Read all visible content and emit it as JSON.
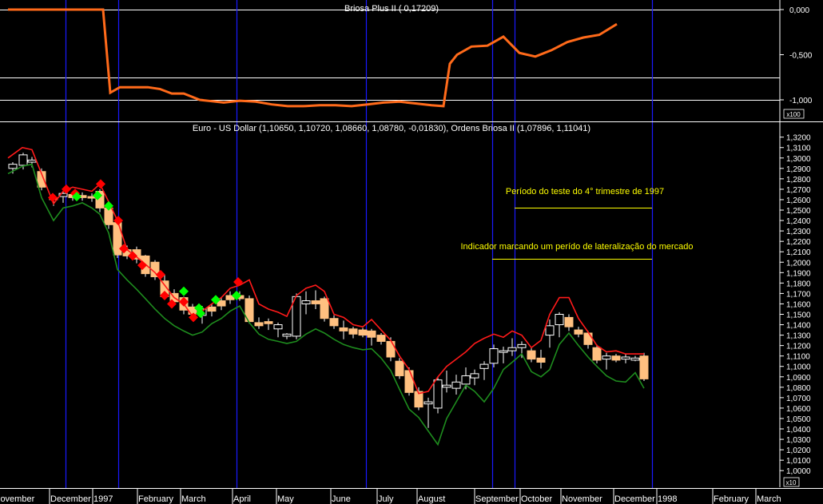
{
  "colors": {
    "background": "#000000",
    "indicator_line": "#ff6a1a",
    "upper_band": "#ff1a1a",
    "lower_band": "#1e8c1e",
    "candle_fill": "#ffc080",
    "annotation": "#ffff00",
    "vertical_marker": "#1a1aff",
    "buy_marker": "#00ff00",
    "sell_marker": "#ff0000"
  },
  "top_panel": {
    "title": "Briosa Plus II ( 0,17209)",
    "unit_label": "x100"
  },
  "main_panel": {
    "title": "Euro - US Dollar (1,10650, 1,10720, 1,08660, 1,08780, -0,01830), Ordens Briosa II (1,07896, 1,11041)",
    "unit_label": "x10"
  },
  "annotations": {
    "test_period": "Período do teste do 4° trimestre de 1997",
    "sideways": "Indicador marcando um perído de lateralização do mercado"
  },
  "chart_data": [
    {
      "type": "line",
      "title": "Briosa Plus II ( 0,17209)",
      "y_ticks": [
        "0,000",
        "-0,500",
        "-1,000"
      ],
      "ylim": [
        -1.1,
        0.0
      ],
      "unit": "x100",
      "series": [
        {
          "name": "Briosa Plus II",
          "x": [
            0,
            3,
            6,
            9,
            11.9,
            12.8,
            14,
            16,
            17.5,
            19,
            20.5,
            22,
            24,
            27,
            29,
            31,
            33,
            35,
            37,
            39,
            41,
            43,
            45,
            47,
            49,
            51,
            53,
            54.5,
            55.3,
            56.2,
            58,
            60,
            62,
            64,
            66,
            68,
            70,
            72,
            74,
            76.2
          ],
          "values": [
            0.0,
            0.0,
            0.0,
            0.0,
            0.0,
            -0.92,
            -0.86,
            -0.86,
            -0.86,
            -0.88,
            -0.93,
            -0.93,
            -1.0,
            -1.03,
            -1.01,
            -1.02,
            -1.05,
            -1.07,
            -1.07,
            -1.06,
            -1.06,
            -1.07,
            -1.05,
            -1.03,
            -1.02,
            -1.04,
            -1.06,
            -1.07,
            -0.6,
            -0.5,
            -0.41,
            -0.4,
            -0.3,
            -0.48,
            -0.52,
            -0.45,
            -0.36,
            -0.31,
            -0.28,
            -0.16
          ]
        }
      ],
      "horizontal_lines": [
        0.0,
        -0.75,
        -1.0
      ]
    },
    {
      "type": "candlestick",
      "title": "Euro - US Dollar (1,10650, 1,10720, 1,08660, 1,08780, -0,01830), Ordens Briosa II (1,07896, 1,11041)",
      "ylim": [
        1.0,
        1.33
      ],
      "y_ticks": [
        "1,3200",
        "1,3100",
        "1,3000",
        "1,2900",
        "1,2800",
        "1,2700",
        "1,2600",
        "1,2500",
        "1,2400",
        "1,2300",
        "1,2200",
        "1,2100",
        "1,2000",
        "1,1900",
        "1,1800",
        "1,1700",
        "1,1600",
        "1,1500",
        "1,1400",
        "1,1300",
        "1,1200",
        "1,1100",
        "1,1000",
        "1,0900",
        "1,0800",
        "1,0700",
        "1,0600",
        "1,0500",
        "1,0400",
        "1,0300",
        "1,0200",
        "1,0100",
        "1,0000"
      ],
      "x_labels": [
        "lovember",
        "December",
        "1997",
        "February",
        "March",
        "April",
        "May",
        "June",
        "July",
        "August",
        "September",
        "October",
        "November",
        "December",
        "1998",
        "February",
        "March"
      ],
      "unit": "x10",
      "candles": [
        {
          "x": 0.6,
          "o": 1.29,
          "h": 1.296,
          "l": 1.285,
          "c": 1.294
        },
        {
          "x": 1.9,
          "o": 1.293,
          "h": 1.305,
          "l": 1.289,
          "c": 1.303
        },
        {
          "x": 3.0,
          "o": 1.296,
          "h": 1.301,
          "l": 1.291,
          "c": 1.298
        },
        {
          "x": 4.2,
          "o": 1.287,
          "h": 1.29,
          "l": 1.269,
          "c": 1.272
        },
        {
          "x": 5.7,
          "o": 1.262,
          "h": 1.265,
          "l": 1.254,
          "c": 1.26
        },
        {
          "x": 6.9,
          "o": 1.263,
          "h": 1.268,
          "l": 1.257,
          "c": 1.266
        },
        {
          "x": 8.1,
          "o": 1.265,
          "h": 1.268,
          "l": 1.259,
          "c": 1.262
        },
        {
          "x": 9.3,
          "o": 1.264,
          "h": 1.267,
          "l": 1.259,
          "c": 1.262
        },
        {
          "x": 10.5,
          "o": 1.263,
          "h": 1.266,
          "l": 1.258,
          "c": 1.262
        },
        {
          "x": 11.5,
          "o": 1.268,
          "h": 1.27,
          "l": 1.248,
          "c": 1.252
        },
        {
          "x": 12.6,
          "o": 1.252,
          "h": 1.256,
          "l": 1.232,
          "c": 1.236
        },
        {
          "x": 13.7,
          "o": 1.238,
          "h": 1.24,
          "l": 1.204,
          "c": 1.207
        },
        {
          "x": 14.9,
          "o": 1.212,
          "h": 1.216,
          "l": 1.203,
          "c": 1.206
        },
        {
          "x": 16.1,
          "o": 1.212,
          "h": 1.215,
          "l": 1.199,
          "c": 1.203
        },
        {
          "x": 17.2,
          "o": 1.206,
          "h": 1.207,
          "l": 1.186,
          "c": 1.189
        },
        {
          "x": 18.4,
          "o": 1.2,
          "h": 1.202,
          "l": 1.183,
          "c": 1.186
        },
        {
          "x": 19.6,
          "o": 1.182,
          "h": 1.188,
          "l": 1.164,
          "c": 1.167
        },
        {
          "x": 20.8,
          "o": 1.17,
          "h": 1.174,
          "l": 1.159,
          "c": 1.162
        },
        {
          "x": 22.0,
          "o": 1.166,
          "h": 1.167,
          "l": 1.15,
          "c": 1.154
        },
        {
          "x": 23.1,
          "o": 1.157,
          "h": 1.16,
          "l": 1.145,
          "c": 1.15
        },
        {
          "x": 24.3,
          "o": 1.149,
          "h": 1.158,
          "l": 1.141,
          "c": 1.155
        },
        {
          "x": 25.5,
          "o": 1.157,
          "h": 1.16,
          "l": 1.148,
          "c": 1.153
        },
        {
          "x": 26.7,
          "o": 1.163,
          "h": 1.166,
          "l": 1.154,
          "c": 1.158
        },
        {
          "x": 27.8,
          "o": 1.168,
          "h": 1.172,
          "l": 1.16,
          "c": 1.164
        },
        {
          "x": 29.0,
          "o": 1.168,
          "h": 1.172,
          "l": 1.163,
          "c": 1.165
        },
        {
          "x": 30.2,
          "o": 1.165,
          "h": 1.168,
          "l": 1.141,
          "c": 1.143
        },
        {
          "x": 31.4,
          "o": 1.142,
          "h": 1.147,
          "l": 1.136,
          "c": 1.139
        },
        {
          "x": 32.6,
          "o": 1.143,
          "h": 1.146,
          "l": 1.135,
          "c": 1.141
        },
        {
          "x": 33.8,
          "o": 1.136,
          "h": 1.142,
          "l": 1.128,
          "c": 1.14
        },
        {
          "x": 34.9,
          "o": 1.129,
          "h": 1.132,
          "l": 1.126,
          "c": 1.131
        },
        {
          "x": 36.1,
          "o": 1.129,
          "h": 1.17,
          "l": 1.126,
          "c": 1.167
        },
        {
          "x": 37.3,
          "o": 1.16,
          "h": 1.172,
          "l": 1.15,
          "c": 1.163
        },
        {
          "x": 38.5,
          "o": 1.163,
          "h": 1.173,
          "l": 1.155,
          "c": 1.16
        },
        {
          "x": 39.6,
          "o": 1.165,
          "h": 1.167,
          "l": 1.143,
          "c": 1.146
        },
        {
          "x": 40.8,
          "o": 1.146,
          "h": 1.149,
          "l": 1.136,
          "c": 1.139
        },
        {
          "x": 42.0,
          "o": 1.137,
          "h": 1.144,
          "l": 1.126,
          "c": 1.134
        },
        {
          "x": 43.2,
          "o": 1.136,
          "h": 1.138,
          "l": 1.127,
          "c": 1.131
        },
        {
          "x": 44.4,
          "o": 1.135,
          "h": 1.137,
          "l": 1.128,
          "c": 1.13
        },
        {
          "x": 45.5,
          "o": 1.134,
          "h": 1.136,
          "l": 1.12,
          "c": 1.128
        },
        {
          "x": 46.7,
          "o": 1.13,
          "h": 1.132,
          "l": 1.121,
          "c": 1.124
        },
        {
          "x": 47.9,
          "o": 1.124,
          "h": 1.128,
          "l": 1.105,
          "c": 1.109
        },
        {
          "x": 49.0,
          "o": 1.105,
          "h": 1.108,
          "l": 1.088,
          "c": 1.091
        },
        {
          "x": 50.2,
          "o": 1.096,
          "h": 1.099,
          "l": 1.072,
          "c": 1.075
        },
        {
          "x": 51.4,
          "o": 1.076,
          "h": 1.08,
          "l": 1.058,
          "c": 1.061
        },
        {
          "x": 52.6,
          "o": 1.064,
          "h": 1.07,
          "l": 1.041,
          "c": 1.066
        },
        {
          "x": 53.8,
          "o": 1.06,
          "h": 1.09,
          "l": 1.055,
          "c": 1.087
        },
        {
          "x": 54.9,
          "o": 1.08,
          "h": 1.096,
          "l": 1.075,
          "c": 1.082
        },
        {
          "x": 56.1,
          "o": 1.079,
          "h": 1.092,
          "l": 1.073,
          "c": 1.085
        },
        {
          "x": 57.3,
          "o": 1.083,
          "h": 1.099,
          "l": 1.078,
          "c": 1.091
        },
        {
          "x": 58.4,
          "o": 1.089,
          "h": 1.097,
          "l": 1.082,
          "c": 1.093
        },
        {
          "x": 59.6,
          "o": 1.098,
          "h": 1.105,
          "l": 1.087,
          "c": 1.102
        },
        {
          "x": 60.8,
          "o": 1.103,
          "h": 1.121,
          "l": 1.099,
          "c": 1.117
        },
        {
          "x": 62.0,
          "o": 1.114,
          "h": 1.119,
          "l": 1.103,
          "c": 1.115
        },
        {
          "x": 63.1,
          "o": 1.115,
          "h": 1.127,
          "l": 1.11,
          "c": 1.118
        },
        {
          "x": 64.3,
          "o": 1.118,
          "h": 1.124,
          "l": 1.108,
          "c": 1.121
        },
        {
          "x": 65.5,
          "o": 1.115,
          "h": 1.118,
          "l": 1.104,
          "c": 1.107
        },
        {
          "x": 66.7,
          "o": 1.108,
          "h": 1.116,
          "l": 1.098,
          "c": 1.104
        },
        {
          "x": 67.8,
          "o": 1.13,
          "h": 1.145,
          "l": 1.118,
          "c": 1.139
        },
        {
          "x": 69.0,
          "o": 1.14,
          "h": 1.152,
          "l": 1.128,
          "c": 1.15
        },
        {
          "x": 70.2,
          "o": 1.147,
          "h": 1.15,
          "l": 1.134,
          "c": 1.138
        },
        {
          "x": 71.4,
          "o": 1.135,
          "h": 1.138,
          "l": 1.128,
          "c": 1.131
        },
        {
          "x": 72.6,
          "o": 1.132,
          "h": 1.134,
          "l": 1.117,
          "c": 1.121
        },
        {
          "x": 73.7,
          "o": 1.118,
          "h": 1.121,
          "l": 1.103,
          "c": 1.106
        },
        {
          "x": 74.9,
          "o": 1.107,
          "h": 1.113,
          "l": 1.097,
          "c": 1.11
        },
        {
          "x": 76.1,
          "o": 1.11,
          "h": 1.112,
          "l": 1.104,
          "c": 1.106
        },
        {
          "x": 77.3,
          "o": 1.107,
          "h": 1.112,
          "l": 1.103,
          "c": 1.109
        },
        {
          "x": 78.5,
          "o": 1.106,
          "h": 1.11,
          "l": 1.105,
          "c": 1.108
        },
        {
          "x": 79.6,
          "o": 1.11,
          "h": 1.113,
          "l": 1.086,
          "c": 1.088
        }
      ],
      "series": [
        {
          "name": "upper",
          "x": [
            0,
            1.8,
            3.0,
            4.2,
            5.7,
            6.9,
            8.1,
            9.3,
            10.5,
            11.5,
            12.6,
            13.7,
            14.9,
            16.1,
            17.2,
            18.4,
            19.6,
            20.8,
            22.0,
            23.1,
            24.3,
            25.5,
            26.7,
            27.8,
            29.0,
            30.2,
            31.4,
            32.6,
            33.8,
            34.9,
            36.1,
            37.3,
            38.5,
            39.6,
            40.8,
            42.0,
            43.2,
            44.4,
            45.5,
            46.7,
            47.9,
            49.0,
            50.2,
            51.4,
            52.6,
            53.8,
            54.9,
            56.1,
            57.3,
            58.4,
            59.6,
            60.8,
            62.0,
            63.1,
            64.3,
            65.5,
            66.7,
            67.8,
            69.0,
            70.2,
            71.4,
            72.6,
            73.7,
            74.9,
            76.1,
            77.3,
            78.5,
            79.6
          ],
          "values": [
            1.3,
            1.31,
            1.308,
            1.285,
            1.256,
            1.268,
            1.272,
            1.27,
            1.268,
            1.275,
            1.258,
            1.24,
            1.212,
            1.205,
            1.198,
            1.19,
            1.178,
            1.166,
            1.16,
            1.148,
            1.153,
            1.16,
            1.166,
            1.175,
            1.178,
            1.183,
            1.16,
            1.155,
            1.152,
            1.148,
            1.168,
            1.175,
            1.178,
            1.172,
            1.15,
            1.147,
            1.14,
            1.138,
            1.145,
            1.135,
            1.125,
            1.11,
            1.097,
            1.074,
            1.076,
            1.09,
            1.1,
            1.107,
            1.114,
            1.122,
            1.127,
            1.131,
            1.128,
            1.134,
            1.13,
            1.118,
            1.125,
            1.15,
            1.166,
            1.166,
            1.146,
            1.133,
            1.12,
            1.114,
            1.115,
            1.112,
            1.112,
            1.112
          ]
        },
        {
          "name": "lower",
          "x": [
            0,
            1.8,
            3.0,
            4.2,
            5.7,
            6.9,
            8.1,
            9.3,
            10.5,
            11.5,
            12.6,
            13.7,
            14.9,
            16.1,
            17.2,
            18.4,
            19.6,
            20.8,
            22.0,
            23.1,
            24.3,
            25.5,
            26.7,
            27.8,
            29.0,
            30.2,
            31.4,
            32.6,
            33.8,
            34.9,
            36.1,
            37.3,
            38.5,
            39.6,
            40.8,
            42.0,
            43.2,
            44.4,
            45.5,
            46.7,
            47.9,
            49.0,
            50.2,
            51.4,
            52.6,
            53.8,
            54.9,
            56.1,
            57.3,
            58.4,
            59.6,
            60.8,
            62.0,
            63.1,
            64.3,
            65.5,
            66.7,
            67.8,
            69.0,
            70.2,
            71.4,
            72.6,
            73.7,
            74.9,
            76.1,
            77.3,
            78.5,
            79.6
          ],
          "values": [
            1.285,
            1.292,
            1.294,
            1.262,
            1.24,
            1.252,
            1.254,
            1.257,
            1.252,
            1.246,
            1.228,
            1.193,
            1.183,
            1.174,
            1.165,
            1.155,
            1.146,
            1.139,
            1.134,
            1.13,
            1.133,
            1.141,
            1.146,
            1.153,
            1.158,
            1.142,
            1.131,
            1.126,
            1.124,
            1.122,
            1.124,
            1.131,
            1.136,
            1.132,
            1.126,
            1.121,
            1.118,
            1.116,
            1.117,
            1.108,
            1.096,
            1.078,
            1.059,
            1.051,
            1.038,
            1.025,
            1.05,
            1.066,
            1.082,
            1.076,
            1.066,
            1.079,
            1.097,
            1.104,
            1.112,
            1.095,
            1.09,
            1.097,
            1.121,
            1.132,
            1.12,
            1.109,
            1.1,
            1.091,
            1.086,
            1.085,
            1.094,
            1.079
          ]
        }
      ],
      "markers": {
        "sell": [
          {
            "x": 5.6,
            "y": 1.262
          },
          {
            "x": 7.3,
            "y": 1.27
          },
          {
            "x": 8.4,
            "y": 1.266
          },
          {
            "x": 11.6,
            "y": 1.275
          },
          {
            "x": 13.8,
            "y": 1.24
          },
          {
            "x": 14.5,
            "y": 1.213
          },
          {
            "x": 15.6,
            "y": 1.206
          },
          {
            "x": 16.8,
            "y": 1.197
          },
          {
            "x": 19.1,
            "y": 1.188
          },
          {
            "x": 19.6,
            "y": 1.168
          },
          {
            "x": 20.5,
            "y": 1.16
          },
          {
            "x": 22.0,
            "y": 1.162
          },
          {
            "x": 23.2,
            "y": 1.147
          },
          {
            "x": 28.8,
            "y": 1.181
          }
        ],
        "buy": [
          {
            "x": 8.6,
            "y": 1.263
          },
          {
            "x": 11.2,
            "y": 1.264
          },
          {
            "x": 12.6,
            "y": 1.254
          },
          {
            "x": 22.0,
            "y": 1.172
          },
          {
            "x": 23.9,
            "y": 1.156
          },
          {
            "x": 24.1,
            "y": 1.151
          },
          {
            "x": 26.0,
            "y": 1.164
          },
          {
            "x": 28.6,
            "y": 1.168
          }
        ],
        "last_small": [
          {
            "x": 28.6,
            "y": 1.168
          }
        ]
      },
      "vertical_markers": [
        7.2,
        13.8,
        28.6,
        44.8,
        60.6,
        63.4,
        80.6
      ],
      "annotation_lines": [
        {
          "x1": 63.4,
          "x2": 80.6,
          "y": 1.252
        },
        {
          "x1": 60.6,
          "x2": 80.6,
          "y": 1.203
        }
      ]
    }
  ]
}
